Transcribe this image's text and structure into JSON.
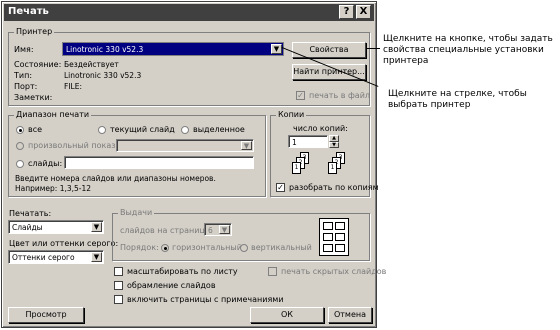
{
  "title": "Печать",
  "title_buttons": {
    "help": "?",
    "close": "X"
  },
  "printer": {
    "group_label": "Принтер",
    "name_label": "Имя:",
    "name_value": "Linotronic 330 v52.3",
    "status_label": "Состояние:",
    "status_value": "Бездействует",
    "type_label": "Тип:",
    "type_value": "Linotronic 330 v52.3",
    "port_label": "Порт:",
    "port_value": "FILE:",
    "comment_label": "Заметки:",
    "properties_button": "Свойства",
    "find_button": "Найти принтер...",
    "print_to_file": "печать в файл"
  },
  "range": {
    "group_label": "Диапазон печати",
    "all": "все",
    "current": "текущий слайд",
    "selection": "выделенное",
    "custom_show": "произвольный показ:",
    "slides": "слайды:",
    "hint": "Введите номера слайдов или диапазоны номеров. Например: 1,3,5-12"
  },
  "copies": {
    "group_label": "Копии",
    "count_label": "число копий:",
    "count_value": "1",
    "collate": "разобрать по копиям"
  },
  "print_what": {
    "label": "Печатать:",
    "value": "Слайды"
  },
  "color": {
    "label": "Цвет или оттенки серого:",
    "value": "Оттенки серого"
  },
  "handouts": {
    "group_label": "Выдачи",
    "per_page_label": "слайдов на странице:",
    "per_page_value": "6",
    "order_label": "Порядок:",
    "horizontal": "горизонтальный",
    "vertical": "вертикальный"
  },
  "options": {
    "scale_to_fit": "масштабировать по листу",
    "frame_slides": "обрамление слайдов",
    "include_comments": "включить страницы с примечаниями",
    "hidden_slides": "печать скрытых слайдов"
  },
  "footer": {
    "preview": "Просмотр",
    "ok": "ОК",
    "cancel": "Отмена"
  },
  "callouts": {
    "properties_note": "Щелкните на кнопке, чтобы задать свойства специальные установки принтера",
    "arrow_note": "Щелкните на стрелке, чтобы выбрать принтер"
  }
}
